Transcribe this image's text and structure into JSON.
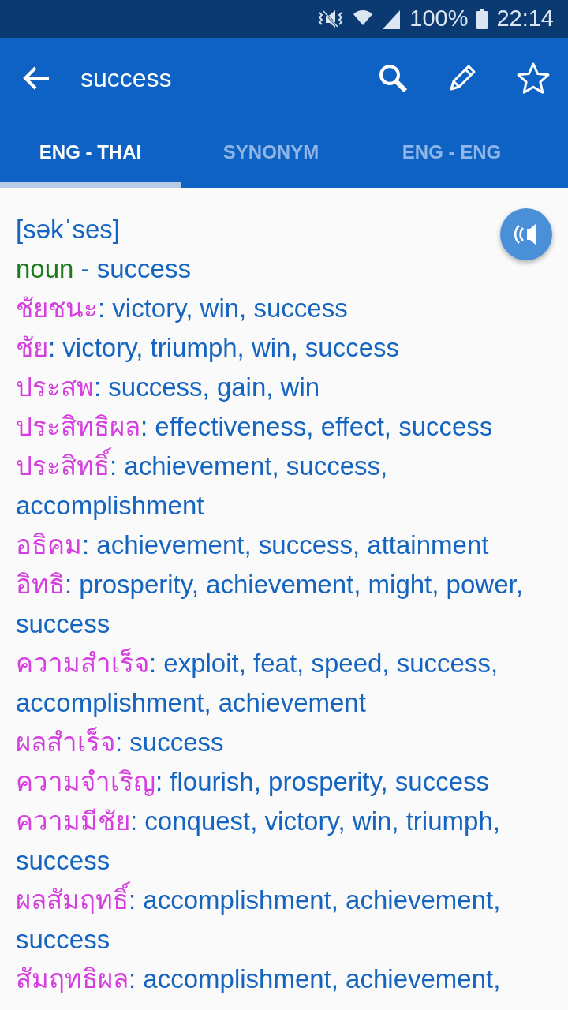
{
  "status_bar": {
    "battery": "100%",
    "time": "22:14"
  },
  "toolbar": {
    "query": "success"
  },
  "tabs": [
    {
      "label": "ENG - THAI",
      "selected": true
    },
    {
      "label": "SYNONYM",
      "selected": false
    },
    {
      "label": "ENG - ENG",
      "selected": false
    }
  ],
  "entry": {
    "pronunciation": "[səkˈses]",
    "part_of_speech": "noun",
    "headword": " - success",
    "translations": [
      {
        "term": "ชัยชนะ",
        "meanings": ": victory, win, success"
      },
      {
        "term": "ชัย",
        "meanings": ": victory, triumph, win, success"
      },
      {
        "term": "ประสพ",
        "meanings": ": success, gain, win"
      },
      {
        "term": "ประสิทธิผล",
        "meanings": ": effectiveness, effect, success"
      },
      {
        "term": "ประสิทธิ์",
        "meanings": ": achievement, success, accomplishment"
      },
      {
        "term": "อธิคม",
        "meanings": ": achievement, success, attainment"
      },
      {
        "term": "อิทธิ",
        "meanings": ": prosperity, achievement, might, power, success"
      },
      {
        "term": "ความสำเร็จ",
        "meanings": ": exploit, feat, speed, success, accomplishment, achievement"
      },
      {
        "term": "ผลสำเร็จ",
        "meanings": ": success"
      },
      {
        "term": "ความจำเริญ",
        "meanings": ": flourish, prosperity, success"
      },
      {
        "term": "ความมีชัย",
        "meanings": ": conquest, victory, win, triumph, success"
      },
      {
        "term": "ผลสัมฤทธิ์",
        "meanings": ": accomplishment, achievement, success"
      },
      {
        "term": "สัมฤทธิผล",
        "meanings": ": accomplishment, achievement,"
      }
    ]
  }
}
